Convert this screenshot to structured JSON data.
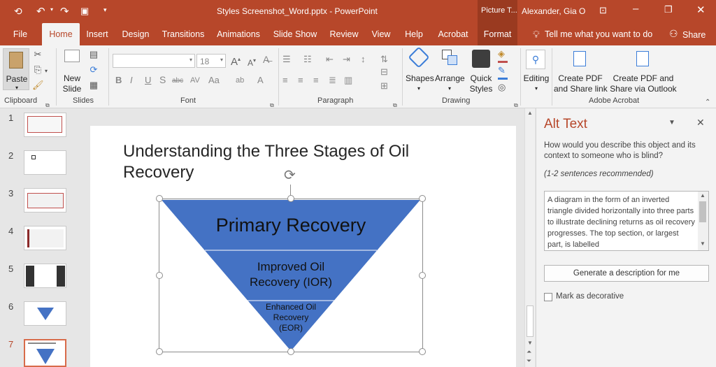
{
  "titlebar": {
    "title": "Styles Screenshot_Word.pptx  -  PowerPoint",
    "context_tab": "Picture T...",
    "user": "Alexander, Gia O"
  },
  "tabs": [
    "File",
    "Home",
    "Insert",
    "Design",
    "Transitions",
    "Animations",
    "Slide Show",
    "Review",
    "View",
    "Help",
    "Acrobat",
    "Format"
  ],
  "tell_me": "Tell me what you want to do",
  "share": "Share",
  "ribbon": {
    "paste": "Paste",
    "new_slide_1": "New",
    "new_slide_2": "Slide",
    "font_size": "18",
    "shapes": "Shapes",
    "arrange": "Arrange",
    "quick_styles_1": "Quick",
    "quick_styles_2": "Styles",
    "editing": "Editing",
    "create_pdf_1": "Create PDF",
    "create_pdf_2": "and Share link",
    "create_pdf_outlook_1": "Create PDF and",
    "create_pdf_outlook_2": "Share via Outlook",
    "groups": {
      "clipboard": "Clipboard",
      "slides": "Slides",
      "font": "Font",
      "paragraph": "Paragraph",
      "drawing": "Drawing",
      "acrobat": "Adobe Acrobat"
    }
  },
  "slides": [
    {
      "num": "1"
    },
    {
      "num": "2"
    },
    {
      "num": "3"
    },
    {
      "num": "4"
    },
    {
      "num": "5"
    },
    {
      "num": "6"
    },
    {
      "num": "7"
    }
  ],
  "slide": {
    "title_line1": "Understanding the Three Stages of Oil",
    "title_line2": "Recovery",
    "stage1": "Primary Recovery",
    "stage2_line1": "Improved Oil",
    "stage2_line2": "Recovery (IOR)",
    "stage3_line1": "Enhanced Oil",
    "stage3_line2": "Recovery",
    "stage3_line3": "(EOR)",
    "fill_color": "#4472c4"
  },
  "alt_text": {
    "title": "Alt Text",
    "prompt": "How would you describe this object and its context to someone who is blind?",
    "hint": "(1-2 sentences recommended)",
    "value": "A diagram in the form of an inverted triangle divided horizontally into three parts to illustrate declining returns as oil recovery progresses. The top section, or largest part, is labelled",
    "generate": "Generate a description for me",
    "decorative": "Mark as decorative"
  },
  "colors": {
    "brand": "#b7472a",
    "accent_text": "#b7472a"
  }
}
